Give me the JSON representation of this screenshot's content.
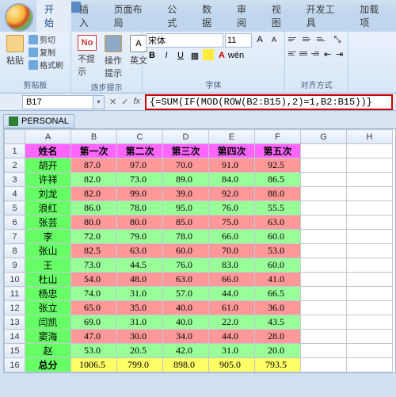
{
  "tabs": [
    "开始",
    "插入",
    "页面布局",
    "公式",
    "数据",
    "审阅",
    "视图",
    "开发工具",
    "加载项"
  ],
  "clipboard": {
    "paste": "粘贴",
    "cut": "剪切",
    "copy": "复制",
    "painter": "格式刷",
    "label": "剪贴板"
  },
  "step": {
    "no": "No",
    "op": "操作提示",
    "en": "英文",
    "label": "逐步提示"
  },
  "font": {
    "name": "宋体",
    "size": "11",
    "label": "字体"
  },
  "align": {
    "label": "对齐方式"
  },
  "namebox": "B17",
  "formula": "{=SUM(IF(MOD(ROW(B2:B15),2)=1,B2:B15))}",
  "wb": "PERSONAL",
  "cols": [
    "A",
    "B",
    "C",
    "D",
    "E",
    "F",
    "G",
    "H"
  ],
  "headers": [
    "姓名",
    "第一次",
    "第二次",
    "第三次",
    "第四次",
    "第五次"
  ],
  "rows": [
    {
      "n": "胡开",
      "v": [
        "87.0",
        "97.0",
        "70.0",
        "91.0",
        "92.5"
      ],
      "c": "r"
    },
    {
      "n": "许祥",
      "v": [
        "82.0",
        "73.0",
        "89.0",
        "84.0",
        "86.5"
      ],
      "c": "g"
    },
    {
      "n": "刘龙",
      "v": [
        "82.0",
        "99.0",
        "39.0",
        "92.0",
        "88.0"
      ],
      "c": "r"
    },
    {
      "n": "浪红",
      "v": [
        "86.0",
        "78.0",
        "95.0",
        "76.0",
        "55.5"
      ],
      "c": "g"
    },
    {
      "n": "张芸",
      "v": [
        "80.0",
        "80.0",
        "85.0",
        "75.0",
        "63.0"
      ],
      "c": "r"
    },
    {
      "n": "李",
      "v": [
        "72.0",
        "79.0",
        "78.0",
        "66.0",
        "60.0"
      ],
      "c": "g"
    },
    {
      "n": "张山",
      "v": [
        "82.5",
        "63.0",
        "60.0",
        "70.0",
        "53.0"
      ],
      "c": "r"
    },
    {
      "n": "王",
      "v": [
        "73.0",
        "44.5",
        "76.0",
        "83.0",
        "60.0"
      ],
      "c": "g"
    },
    {
      "n": "杜山",
      "v": [
        "54.0",
        "48.0",
        "63.0",
        "66.0",
        "41.0"
      ],
      "c": "r"
    },
    {
      "n": "杨忠",
      "v": [
        "74.0",
        "31.0",
        "57.0",
        "44.0",
        "66.5"
      ],
      "c": "g"
    },
    {
      "n": "张立",
      "v": [
        "65.0",
        "35.0",
        "40.0",
        "61.0",
        "36.0"
      ],
      "c": "r"
    },
    {
      "n": "闫凯",
      "v": [
        "69.0",
        "31.0",
        "40.0",
        "22.0",
        "43.5"
      ],
      "c": "g"
    },
    {
      "n": "窦海",
      "v": [
        "47.0",
        "30.0",
        "34.0",
        "44.0",
        "28.0"
      ],
      "c": "r"
    },
    {
      "n": "赵",
      "v": [
        "53.0",
        "20.5",
        "42.0",
        "31.0",
        "20.0"
      ],
      "c": "g"
    }
  ],
  "total": {
    "label": "总分",
    "v": [
      "1006.5",
      "799.0",
      "898.0",
      "905.0",
      "793.5"
    ]
  }
}
